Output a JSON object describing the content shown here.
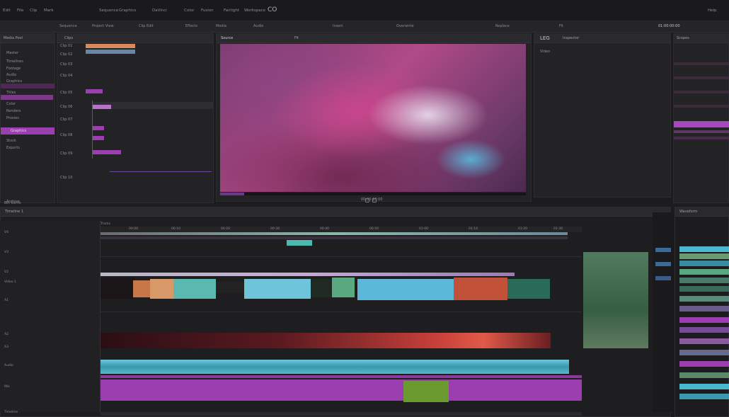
{
  "menubar": {
    "items": [
      "Edit",
      "File",
      "Clip",
      "Mark",
      "Sequence",
      "Graphics",
      "DaVinci",
      "Color",
      "Fusion",
      "Fairlight",
      "Workspace",
      "Help"
    ],
    "center_title": "CO"
  },
  "toolbar": {
    "items": [
      "Sequence",
      "Project View",
      "Clip Edit",
      "Effects",
      "Media",
      "Audio",
      "Insert",
      "Overwrite",
      "Replace",
      "Fit"
    ],
    "timecode": "01:00:00:00"
  },
  "media_pool": {
    "title": "Media Pool",
    "header_label": "Master",
    "folders": [
      "Master",
      "Timelines",
      "Footage",
      "Audio",
      "Graphics",
      "Titles",
      "Color",
      "Renders",
      "Proxies",
      "Stock",
      "Exports",
      "Archive"
    ],
    "selected_folder": "Graphics",
    "footer": "Bin Items"
  },
  "inspector_list": {
    "title": "Clips",
    "rows": [
      "Clip 01",
      "Clip 02",
      "Clip 03",
      "Clip 04",
      "Clip 05",
      "Clip 06",
      "Clip 07",
      "Clip 08",
      "Clip 09",
      "Clip 10"
    ]
  },
  "viewer": {
    "title": "Source",
    "zoom": "Fit",
    "timecode": "00:00:10:00"
  },
  "right_panel": {
    "title": "LEG",
    "tab": "Inspector",
    "sub_label": "Video"
  },
  "scopes_panel": {
    "title": "Scopes",
    "tab": "Waveform"
  },
  "timeline": {
    "title": "Timeline 1",
    "header_label": "Tracks",
    "track_labels": [
      "V4",
      "V3",
      "V2",
      "Video 1",
      "A1",
      "A2",
      "A3",
      "Audio",
      "Mix"
    ],
    "ruler_marks": [
      "00:00",
      "00:10",
      "00:20",
      "00:30",
      "00:40",
      "00:50",
      "01:00",
      "01:10",
      "01:20",
      "01:30",
      "01:40"
    ],
    "footer": "Timeline"
  },
  "colors": {
    "background": "#1c1c1e",
    "accent_purple": "#9b3fb0",
    "teal": "#4cb8d0",
    "orange": "#d88a5a",
    "red": "#b8302a",
    "green": "#3e8a55"
  }
}
